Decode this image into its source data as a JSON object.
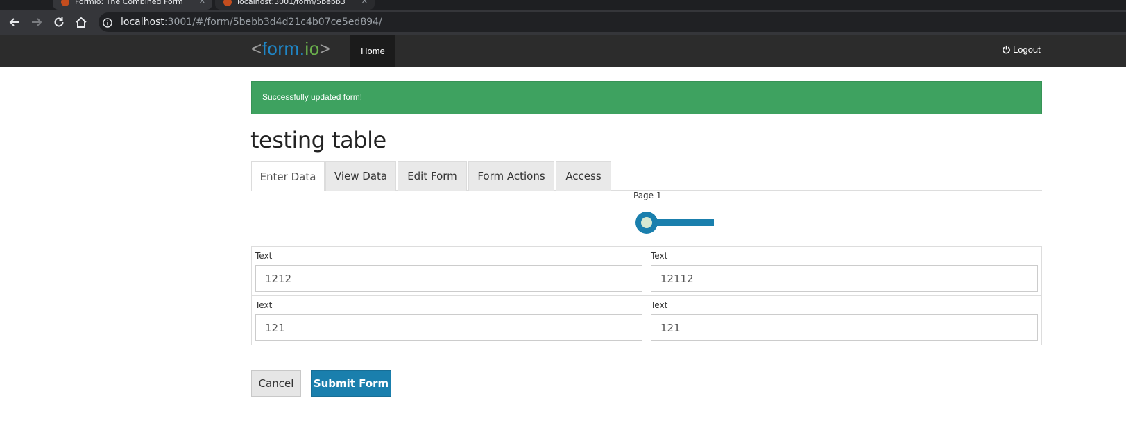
{
  "browser": {
    "tabs": [
      {
        "title": "Formio: The Combined Form",
        "icon": "formio-favicon"
      },
      {
        "title": "localhost:3001/form/5bebb3",
        "icon": "formio-favicon"
      }
    ],
    "url": {
      "host": "localhost",
      "rest": ":3001/#/form/5bebb3d4d21c4b07ce5ed894/"
    }
  },
  "navbar": {
    "brand": {
      "lt": "<",
      "form": "form",
      "dot": ".",
      "io": "io",
      "gt": ">"
    },
    "home_label": "Home",
    "logout_label": "Logout",
    "logout_icon": "power-icon"
  },
  "alert": {
    "message": "Successfully updated form!"
  },
  "form": {
    "title": "testing table",
    "tabs": [
      {
        "label": "Enter Data",
        "active": true
      },
      {
        "label": "View Data",
        "active": false
      },
      {
        "label": "Edit Form",
        "active": false
      },
      {
        "label": "Form Actions",
        "active": false
      },
      {
        "label": "Access",
        "active": false
      }
    ],
    "wizard": {
      "page_label": "Page 1"
    },
    "table": [
      {
        "label": "Text",
        "value": "1212"
      },
      {
        "label": "Text",
        "value": "12112"
      },
      {
        "label": "Text",
        "value": "121"
      },
      {
        "label": "Text",
        "value": "121"
      }
    ],
    "buttons": {
      "cancel": "Cancel",
      "submit": "Submit Form"
    }
  },
  "colors": {
    "navbar_bg": "#2c2c2c",
    "alert_success": "#3ea260",
    "primary": "#1a7fad",
    "brand_blue": "#1f86c7",
    "brand_green": "#6ab04c"
  }
}
